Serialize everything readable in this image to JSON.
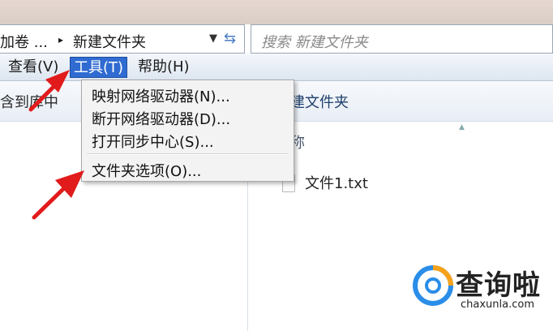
{
  "address": {
    "crumb_1": "加卷 ...",
    "crumb_sep": "▸",
    "crumb_2": "新建文件夹"
  },
  "search": {
    "placeholder": "搜索 新建文件夹"
  },
  "menubar": {
    "view": "查看(V)",
    "tools": "工具(T)",
    "help": "帮助(H)"
  },
  "tools_menu": {
    "items": [
      "映射网络驱动器(N)...",
      "断开网络驱动器(D)...",
      "打开同步中心(S)...",
      "文件夹选项(O)..."
    ]
  },
  "left_pane": {
    "header_text": "含到库中"
  },
  "right_pane": {
    "title": "建文件夹",
    "column_name": "称",
    "file_name": "文件1.txt"
  },
  "watermark": {
    "brand": "查询啦",
    "url": "chaxunla.com"
  },
  "colors": {
    "menu_highlight": "#2f6bd1",
    "arrow_red": "#e11b1b",
    "watermark_blue": "#2a8ee8",
    "watermark_orange": "#f7a21b"
  }
}
